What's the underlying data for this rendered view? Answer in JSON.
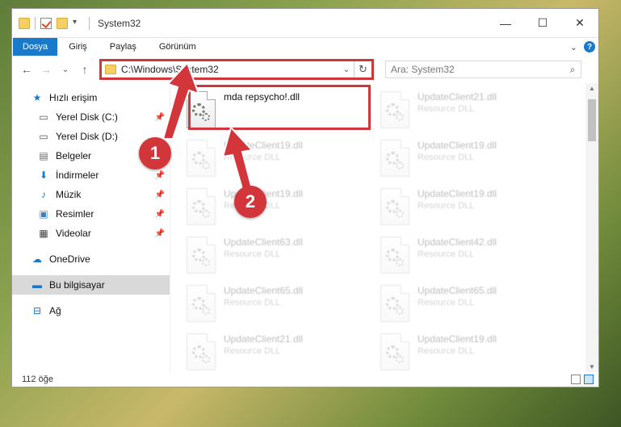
{
  "titlebar": {
    "title": "System32",
    "minimize": "—",
    "maximize": "☐",
    "close": "✕"
  },
  "ribbon": {
    "file_tab": "Dosya",
    "tabs": [
      "Giriş",
      "Paylaş",
      "Görünüm"
    ],
    "expand": "⌄",
    "help": "?"
  },
  "nav": {
    "back": "←",
    "forward": "→",
    "recent": "⌄",
    "up": "↑",
    "address": "C:\\Windows\\System32",
    "address_dropdown": "⌄",
    "refresh": "↻",
    "search_placeholder": "Ara: System32",
    "search_icon": "⌕"
  },
  "sidebar": {
    "quick_access": "Hızlı erişim",
    "items": [
      {
        "label": "Yerel Disk (C:)",
        "icon": "drive-icon"
      },
      {
        "label": "Yerel Disk (D:)",
        "icon": "drive-icon"
      },
      {
        "label": "Belgeler",
        "icon": "documents-icon"
      },
      {
        "label": "İndirmeler",
        "icon": "download-icon"
      },
      {
        "label": "Müzik",
        "icon": "music-icon"
      },
      {
        "label": "Resimler",
        "icon": "pictures-icon"
      },
      {
        "label": "Videolar",
        "icon": "videos-icon"
      }
    ],
    "onedrive": "OneDrive",
    "this_pc": "Bu bilgisayar",
    "network": "Ağ"
  },
  "files": [
    {
      "name": "mda repsycho!.dll",
      "type": "",
      "focused": true
    },
    {
      "name": "UpdateClient21.dll",
      "type": "Resource DLL"
    },
    {
      "name": "UpdateClient19.dll",
      "type": "Resource DLL"
    },
    {
      "name": "UpdateClient19.dll",
      "type": "Resource DLL"
    },
    {
      "name": "UpdateClient19.dll",
      "type": "Resource DLL"
    },
    {
      "name": "UpdateClient19.dll",
      "type": "Resource DLL"
    },
    {
      "name": "UpdateClient63.dll",
      "type": "Resource DLL"
    },
    {
      "name": "UpdateClient42.dll",
      "type": "Resource DLL"
    },
    {
      "name": "UpdateClient65.dll",
      "type": "Resource DLL"
    },
    {
      "name": "UpdateClient65.dll",
      "type": "Resource DLL"
    },
    {
      "name": "UpdateClient21.dll",
      "type": "Resource DLL"
    },
    {
      "name": "UpdateClient19.dll",
      "type": "Resource DLL"
    }
  ],
  "status": {
    "count": "112 öğe"
  },
  "annotations": {
    "badge1": "1",
    "badge2": "2"
  },
  "colors": {
    "accent": "#1979ca",
    "highlight": "#d2363b"
  }
}
